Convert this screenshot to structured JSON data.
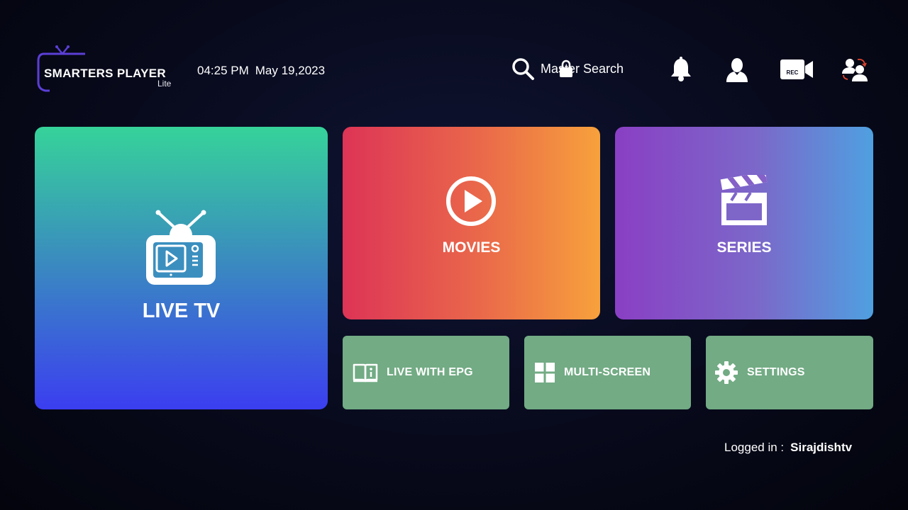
{
  "app": {
    "logo_main": "SMARTERS PLAYER",
    "logo_sub": "Lite"
  },
  "header": {
    "time": "04:25 PM",
    "date": "May 19,2023",
    "search_label": "Master Search",
    "icons": [
      "notification-bell-icon",
      "profile-icon",
      "record-camera-icon",
      "switch-user-icon"
    ]
  },
  "tiles": {
    "live_tv": "LIVE TV",
    "movies": "MOVIES",
    "series": "SERIES",
    "live_epg": "LIVE WITH EPG",
    "multi_screen": "MULTI-SCREEN",
    "settings": "SETTINGS"
  },
  "footer": {
    "logged_in_label": "Logged in :",
    "username": "Sirajdishtv"
  },
  "colors": {
    "background": "#080a1c",
    "small_tile": "#72ab84",
    "logo_accent": "#5b3fd6"
  }
}
